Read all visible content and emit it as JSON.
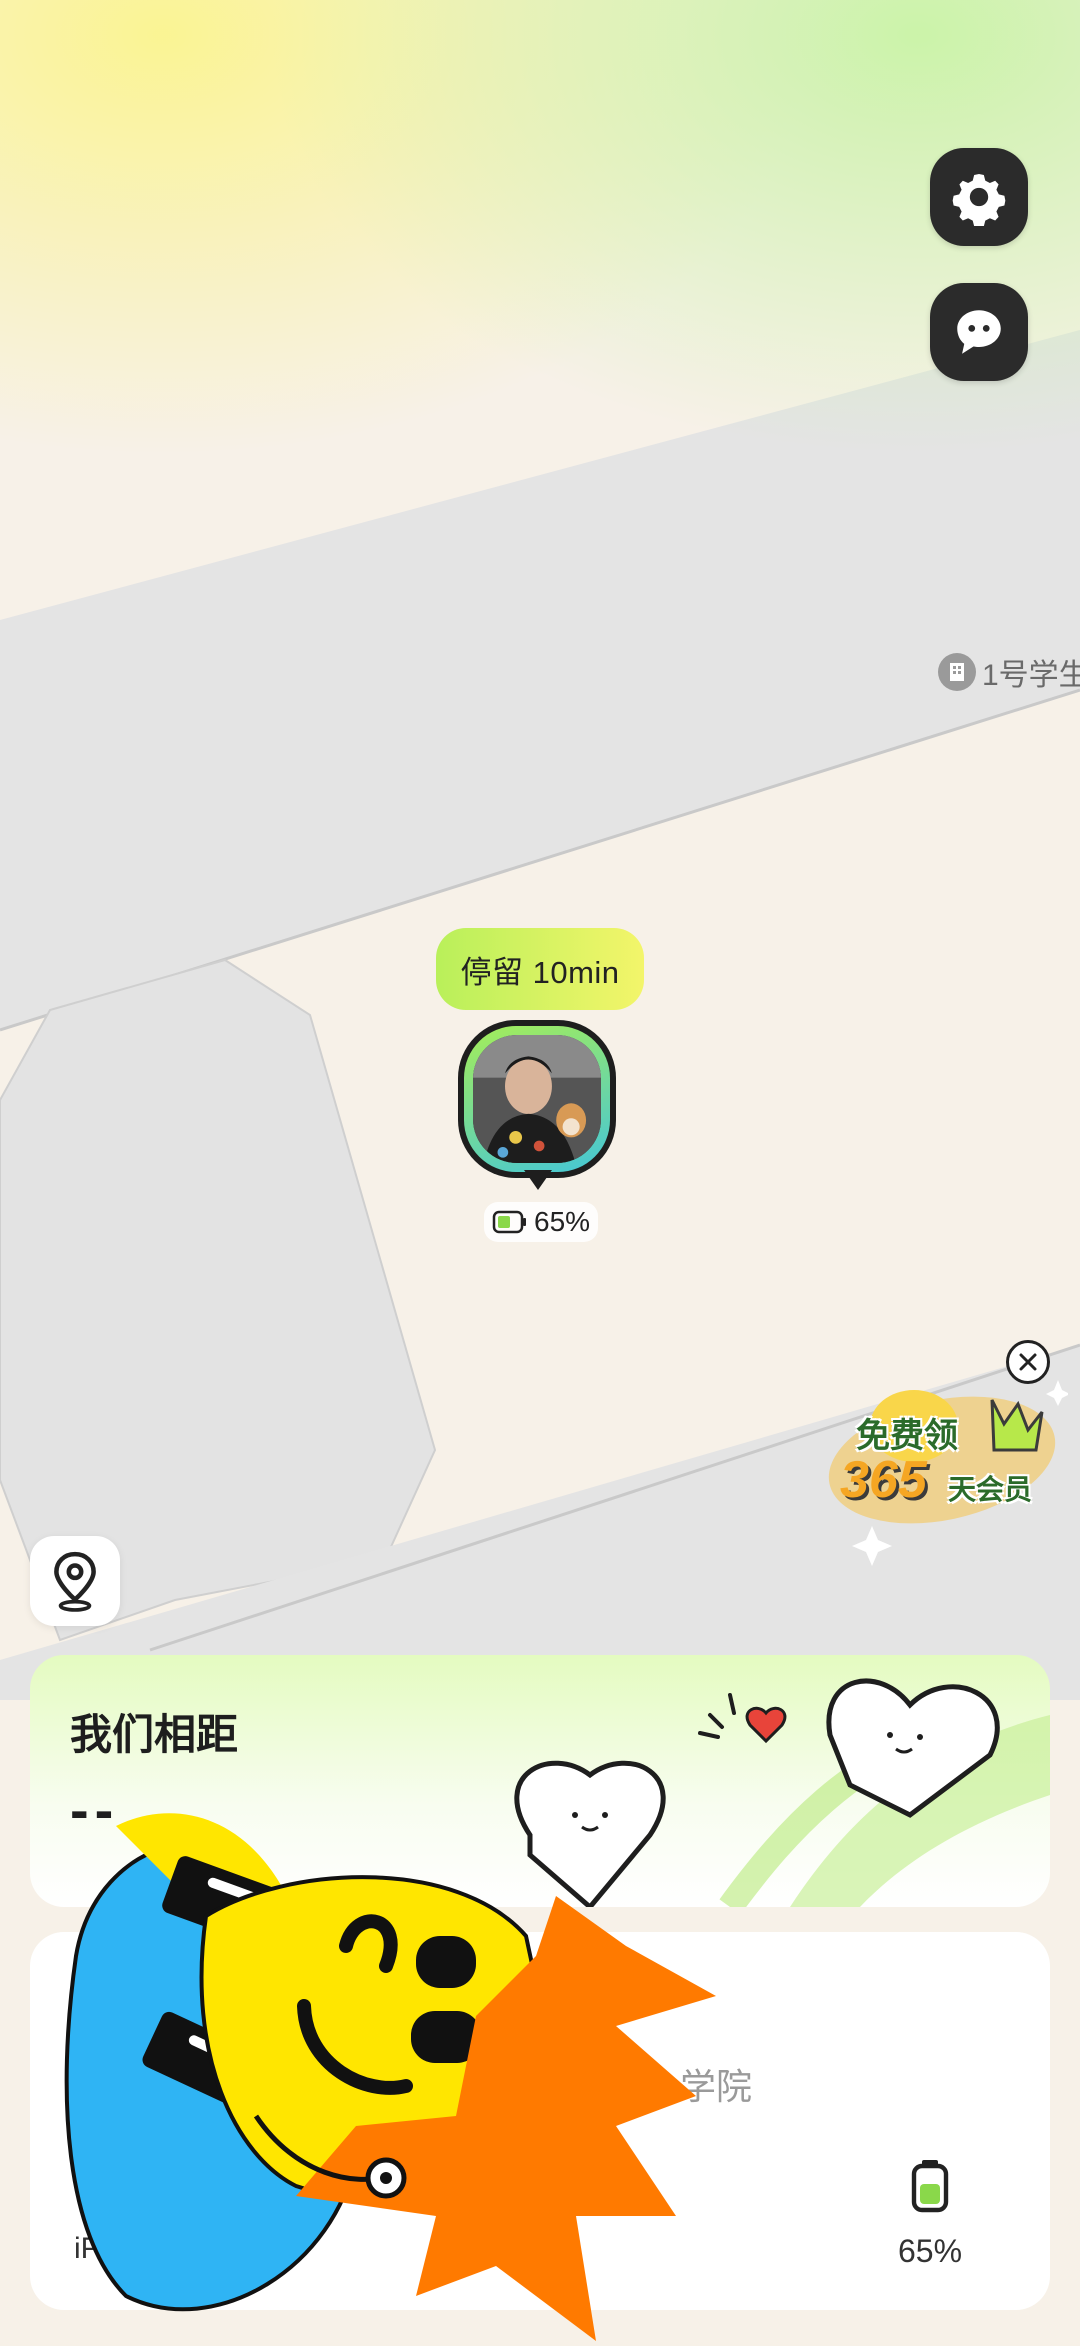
{
  "map": {
    "poi_label": "1号学生",
    "stay_label": "停留 10min",
    "battery_label": "65%"
  },
  "buttons": {
    "settings_icon": "gear-icon",
    "chat_icon": "chat-bubble-icon",
    "locate_icon": "location-pin-icon"
  },
  "promo": {
    "line1": "免费领",
    "line2_number": "365",
    "line2_text": "天会员"
  },
  "distance_card": {
    "title": "我们相距",
    "value": "--"
  },
  "info_card": {
    "location_text": "学院",
    "device_text": "iPho",
    "battery_percent": "65%"
  },
  "colors": {
    "accent_green": "#a6ee57",
    "accent_yellow": "#f3f56a",
    "button_dark": "#2b2b2b"
  }
}
